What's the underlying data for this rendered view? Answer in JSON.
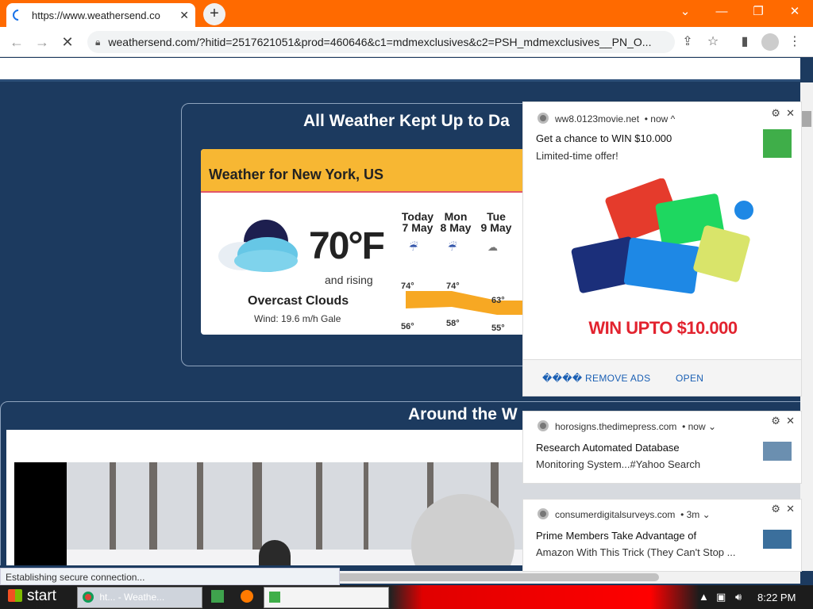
{
  "browser": {
    "tab_title": "https://www.weathersend.co",
    "tab_close": "✕",
    "new_tab": "+",
    "url": "weathersend.com/?hitid=2517621051&prod=460646&c1=mdmexclusives&c2=PSH_mdmexclusives__PN_O...",
    "window_controls": [
      "⌄",
      "—",
      "❐",
      "✕"
    ]
  },
  "page": {
    "heading": "All Weather Kept Up to Da",
    "card_title": "Weather for New York, US",
    "temperature": "70°F",
    "trend": "and rising",
    "condition": "Overcast Clouds",
    "wind": "Wind: 19.6 m/h Gale",
    "days": [
      {
        "name": "Today",
        "date": "7 May",
        "hi": "74°",
        "lo": "56°",
        "icon": "rain-icon"
      },
      {
        "name": "Mon",
        "date": "8 May",
        "hi": "74°",
        "lo": "58°",
        "icon": "rain-icon"
      },
      {
        "name": "Tue",
        "date": "9 May",
        "hi": "63°",
        "lo": "55°",
        "icon": "cloudy-icon"
      }
    ],
    "around_heading": "Around the W"
  },
  "status_text": "Establishing secure connection...",
  "notifications": [
    {
      "source": "ww8.0123movie.net",
      "time": "• now ^",
      "title": "Get a chance to WIN $10.000",
      "body": "Limited-time offer!",
      "banner": "WIN UPTO $10.000",
      "actions": [
        "���� REMOVE ADS",
        "OPEN"
      ]
    },
    {
      "source": "horosigns.thedimepress.com",
      "time": "• now ⌄",
      "title": "Research Automated Database",
      "body": "Monitoring System...#Yahoo Search"
    },
    {
      "source": "consumerdigitalsurveys.com",
      "time": "• 3m ⌄",
      "title": "Prime Members Take Advantage of",
      "body": "Amazon With This Trick (They Can't Stop ..."
    }
  ],
  "taskbar": {
    "start": "start",
    "task1": "ht... - Weathe...",
    "task2": "",
    "clock": "8:22 PM"
  },
  "colors": {
    "titlebar": "#ff6a00",
    "page_bg": "#1c3a5f",
    "card_header": "#f7b733",
    "ad_red": "#e2232f"
  }
}
